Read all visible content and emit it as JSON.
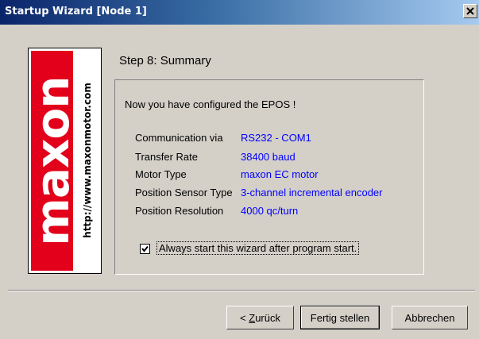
{
  "window": {
    "title": "Startup Wizard  [Node 1]"
  },
  "logo": {
    "wordmark": "maxon",
    "url": "http://www.maxonmotor.com",
    "colors": {
      "red": "#e2001a",
      "white": "#ffffff"
    }
  },
  "step": {
    "title": "Step 8: Summary"
  },
  "summary": {
    "intro": "Now you have configured the EPOS !",
    "rows": [
      {
        "label": "Communication via",
        "value": "RS232 - COM1"
      },
      {
        "label": "Transfer Rate",
        "value": "38400 baud"
      },
      {
        "label": "Motor Type",
        "value": "maxon EC motor"
      },
      {
        "label": "Position Sensor Type",
        "value": "3-channel incremental encoder"
      },
      {
        "label": "Position Resolution",
        "value": "4000 qc/turn"
      }
    ],
    "value_color": "#0000ff"
  },
  "checkbox": {
    "label": "Always start this wizard after program start.",
    "checked": true
  },
  "buttons": {
    "back_prefix": "< ",
    "back_hotkey": "Z",
    "back_rest": "urück",
    "finish": "Fertig stellen",
    "cancel": "Abbrechen"
  },
  "icons": {
    "close": "close-icon",
    "check": "checkmark-icon"
  }
}
